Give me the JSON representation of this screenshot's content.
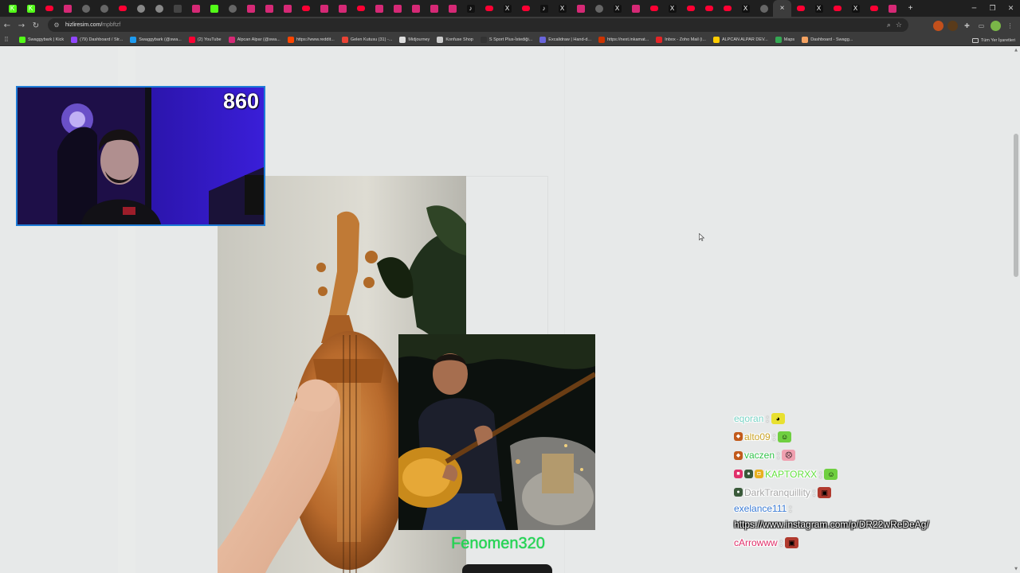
{
  "browser": {
    "tabs": [
      {
        "icon": "kick-icon",
        "color": "#53fc18",
        "glyph": "K"
      },
      {
        "icon": "kick-icon",
        "color": "#53fc18",
        "glyph": "K"
      },
      {
        "icon": "youtube-icon",
        "color": "#ff0033",
        "glyph": ""
      },
      {
        "icon": "instagram-icon",
        "color": "#d62976",
        "glyph": ""
      },
      {
        "icon": "draw-icon",
        "color": "#666666",
        "glyph": ""
      },
      {
        "icon": "draw-icon",
        "color": "#666666",
        "glyph": ""
      },
      {
        "icon": "youtube-icon",
        "color": "#ff0033",
        "glyph": ""
      },
      {
        "icon": "chrome-icon",
        "color": "#888888",
        "glyph": ""
      },
      {
        "icon": "chrome-icon",
        "color": "#888888",
        "glyph": ""
      },
      {
        "icon": "tab-icon",
        "color": "#444444",
        "glyph": ""
      },
      {
        "icon": "instagram-icon",
        "color": "#d62976",
        "glyph": ""
      },
      {
        "icon": "kick-icon",
        "color": "#53fc18",
        "glyph": ""
      },
      {
        "icon": "draw-icon",
        "color": "#666666",
        "glyph": ""
      },
      {
        "icon": "instagram-icon",
        "color": "#d62976",
        "glyph": ""
      },
      {
        "icon": "instagram-icon",
        "color": "#d62976",
        "glyph": ""
      },
      {
        "icon": "instagram-icon",
        "color": "#d62976",
        "glyph": ""
      },
      {
        "icon": "youtube-icon",
        "color": "#ff0033",
        "glyph": ""
      },
      {
        "icon": "instagram-icon",
        "color": "#d62976",
        "glyph": ""
      },
      {
        "icon": "instagram-icon",
        "color": "#d62976",
        "glyph": ""
      },
      {
        "icon": "youtube-icon",
        "color": "#ff0033",
        "glyph": ""
      },
      {
        "icon": "instagram-icon",
        "color": "#d62976",
        "glyph": ""
      },
      {
        "icon": "instagram-icon",
        "color": "#d62976",
        "glyph": ""
      },
      {
        "icon": "instagram-icon",
        "color": "#d62976",
        "glyph": ""
      },
      {
        "icon": "instagram-icon",
        "color": "#d62976",
        "glyph": ""
      },
      {
        "icon": "instagram-icon",
        "color": "#d62976",
        "glyph": ""
      },
      {
        "icon": "tiktok-icon",
        "color": "#111111",
        "glyph": "♪"
      },
      {
        "icon": "youtube-icon",
        "color": "#ff0033",
        "glyph": ""
      },
      {
        "icon": "x-icon",
        "color": "#111111",
        "glyph": "X"
      },
      {
        "icon": "youtube-icon",
        "color": "#ff0033",
        "glyph": ""
      },
      {
        "icon": "tiktok-icon",
        "color": "#111111",
        "glyph": "♪"
      },
      {
        "icon": "x-icon",
        "color": "#111111",
        "glyph": "X"
      },
      {
        "icon": "instagram-icon",
        "color": "#d62976",
        "glyph": ""
      },
      {
        "icon": "draw-icon",
        "color": "#666666",
        "glyph": ""
      },
      {
        "icon": "x-icon",
        "color": "#111111",
        "glyph": "X"
      },
      {
        "icon": "instagram-icon",
        "color": "#d62976",
        "glyph": ""
      },
      {
        "icon": "youtube-icon",
        "color": "#ff0033",
        "glyph": ""
      },
      {
        "icon": "x-icon",
        "color": "#111111",
        "glyph": "X"
      },
      {
        "icon": "youtube-icon",
        "color": "#ff0033",
        "glyph": ""
      },
      {
        "icon": "youtube-icon",
        "color": "#ff0033",
        "glyph": ""
      },
      {
        "icon": "youtube-icon",
        "color": "#ff0033",
        "glyph": ""
      },
      {
        "icon": "x-icon",
        "color": "#111111",
        "glyph": "X"
      },
      {
        "icon": "draw-icon",
        "color": "#666666",
        "glyph": ""
      },
      {
        "icon": "close-icon",
        "color": "#3c3c3c",
        "glyph": "×",
        "active": true
      },
      {
        "icon": "youtube-icon",
        "color": "#ff0033",
        "glyph": ""
      },
      {
        "icon": "x-icon",
        "color": "#111111",
        "glyph": "X"
      },
      {
        "icon": "youtube-icon",
        "color": "#ff0033",
        "glyph": ""
      },
      {
        "icon": "x-icon",
        "color": "#111111",
        "glyph": "X"
      },
      {
        "icon": "youtube-icon",
        "color": "#ff0033",
        "glyph": ""
      },
      {
        "icon": "instagram-icon",
        "color": "#d62976",
        "glyph": ""
      },
      {
        "icon": "new-tab-icon",
        "color": "#1f1f1f",
        "glyph": "+"
      }
    ],
    "url": "hizliresim.com/",
    "url_path": "mpbftzf",
    "bookmarks": [
      {
        "label": "Swaggybark | Kick",
        "color": "#53fc18"
      },
      {
        "label": "(79) Dashboard / Str...",
        "color": "#9146ff"
      },
      {
        "label": "Swaggybark (@swa...",
        "color": "#1d9bf0"
      },
      {
        "label": "(2) YouTube",
        "color": "#ff0033"
      },
      {
        "label": "Alpcan Alpar (@swa...",
        "color": "#d62976"
      },
      {
        "label": "https://www.reddit...",
        "color": "#ff4500"
      },
      {
        "label": "Gelen Kutusu (31) -...",
        "color": "#ea4335"
      },
      {
        "label": "Midjourney",
        "color": "#dddddd"
      },
      {
        "label": "Konfuse Shop",
        "color": "#cccccc"
      },
      {
        "label": "S Sport Plus-İstediği...",
        "color": "#333333"
      },
      {
        "label": "Excalidraw | Hand-d...",
        "color": "#6965db"
      },
      {
        "label": "https://next.inkamat...",
        "color": "#cc3300"
      },
      {
        "label": "Inbox - Zoho Mail (i...",
        "color": "#e42527"
      },
      {
        "label": "ALPCAN ALPAR DEV...",
        "color": "#ffcc00"
      },
      {
        "label": "Maps",
        "color": "#34a853"
      },
      {
        "label": "Dashboard - Swagg...",
        "color": "#f4a261"
      }
    ],
    "bookmarks_right": "Tüm Yer İşaretleri"
  },
  "stream": {
    "counter": "860",
    "featured_user": "Fenomen320",
    "chat": [
      {
        "user": "eqoran",
        "color": "#7ad4c6",
        "badges": [],
        "emote": {
          "name": "pepe-wave-emote",
          "bg": "#e8e030",
          "glyph": "◕"
        }
      },
      {
        "user": "alto09",
        "color": "#c9a227",
        "badges": [
          {
            "name": "sub-badge",
            "color": "#c25a1b",
            "glyph": "◆"
          }
        ],
        "emote": {
          "name": "pepe-laugh-emote",
          "bg": "#6fcf40",
          "glyph": "☺"
        }
      },
      {
        "user": "vaczen",
        "color": "#31c24a",
        "badges": [
          {
            "name": "sub-badge",
            "color": "#c25a1b",
            "glyph": "◆"
          }
        ],
        "emote": {
          "name": "pepe-cry-emote",
          "bg": "#f0a0b0",
          "glyph": "☹"
        }
      },
      {
        "user": "KAPTORXX",
        "color": "#64e040",
        "badges": [
          {
            "name": "gift-badge",
            "color": "#e0306a",
            "glyph": "■"
          },
          {
            "name": "mod-badge",
            "color": "#3a5a3a",
            "glyph": "●"
          },
          {
            "name": "vip-badge",
            "color": "#e8b020",
            "glyph": "◘"
          }
        ],
        "emote": {
          "name": "pepe-laugh-emote",
          "bg": "#6fcf40",
          "glyph": "☺"
        }
      },
      {
        "user": "DarkTranquillity",
        "color": "#a7a7a7",
        "badges": [
          {
            "name": "mod-badge",
            "color": "#3a5a3a",
            "glyph": "●"
          }
        ],
        "emote": {
          "name": "angry-emote",
          "bg": "#b03a2e",
          "glyph": "▣"
        }
      },
      {
        "user": "exelance111",
        "color": "#3a7bd5",
        "badges": [],
        "link": "https://www.instagram.com/p/DR22wReDeAg/"
      },
      {
        "user": "cArrowww",
        "color": "#e0306a",
        "badges": [],
        "emote": {
          "name": "angry-emote",
          "bg": "#b03a2e",
          "glyph": "▣"
        }
      }
    ]
  }
}
